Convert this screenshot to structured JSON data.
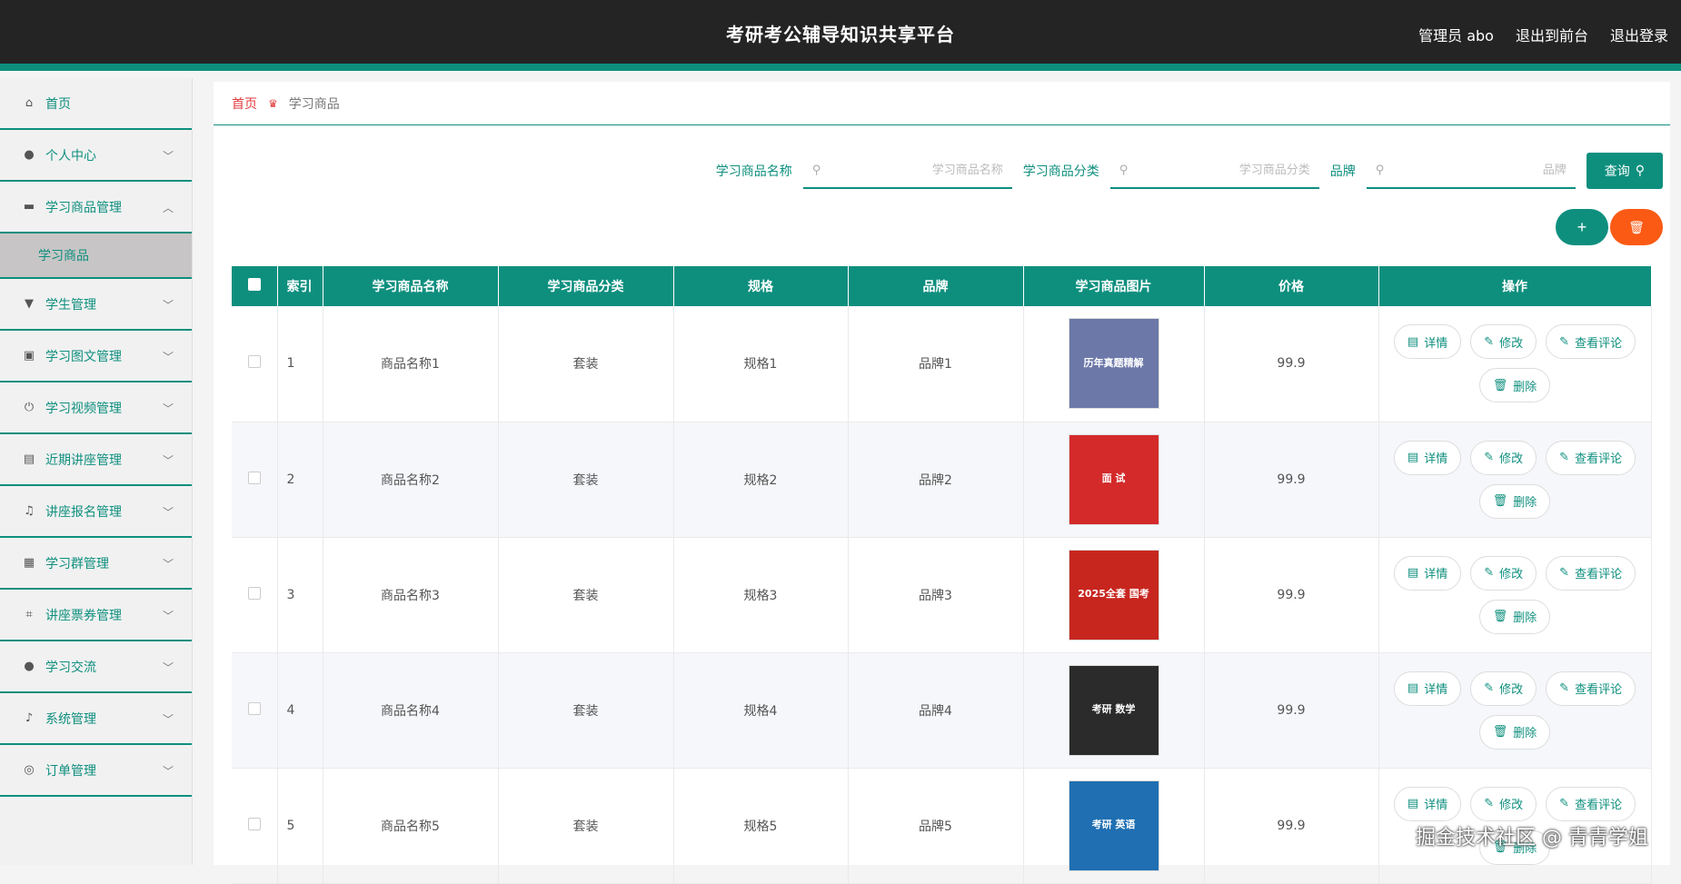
{
  "header": {
    "title": "考研考公辅导知识共享平台",
    "admin": "管理员 abo",
    "front_link": "退出到前台",
    "logout": "退出登录"
  },
  "sidebar": {
    "items": [
      {
        "label": "首页",
        "icon": "home-icon",
        "glyph": "⌂",
        "expandable": false
      },
      {
        "label": "个人中心",
        "icon": "user-icon",
        "glyph": "●",
        "expandable": true
      },
      {
        "label": "学习商品管理",
        "icon": "chat-icon",
        "glyph": "▬",
        "expandable": true,
        "expanded": true
      },
      {
        "label": "学生管理",
        "icon": "monitor-icon",
        "glyph": "▼",
        "expandable": true
      },
      {
        "label": "学习图文管理",
        "icon": "clipboard-icon",
        "glyph": "▣",
        "expandable": true
      },
      {
        "label": "学习视频管理",
        "icon": "power-icon",
        "glyph": "⏻",
        "expandable": true
      },
      {
        "label": "近期讲座管理",
        "icon": "briefcase-icon",
        "glyph": "▤",
        "expandable": true
      },
      {
        "label": "讲座报名管理",
        "icon": "bell-off-icon",
        "glyph": "♫",
        "expandable": true
      },
      {
        "label": "学习群管理",
        "icon": "clipboard-check-icon",
        "glyph": "▦",
        "expandable": true
      },
      {
        "label": "讲座票券管理",
        "icon": "crop-icon",
        "glyph": "⌗",
        "expandable": true
      },
      {
        "label": "学习交流",
        "icon": "person-icon",
        "glyph": "●",
        "expandable": true
      },
      {
        "label": "系统管理",
        "icon": "mic-icon",
        "glyph": "♪",
        "expandable": true
      },
      {
        "label": "订单管理",
        "icon": "compass-icon",
        "glyph": "◎",
        "expandable": true
      }
    ],
    "submenu": {
      "label": "学习商品"
    }
  },
  "breadcrumb": {
    "home": "首页",
    "current": "学习商品"
  },
  "search": {
    "name_label": "学习商品名称",
    "name_placeholder": "学习商品名称",
    "category_label": "学习商品分类",
    "category_placeholder": "学习商品分类",
    "brand_label": "品牌",
    "brand_placeholder": "品牌",
    "query_button": "查询"
  },
  "actions": {
    "add": "+",
    "delete": "🗑"
  },
  "table": {
    "headers": [
      "索引",
      "学习商品名称",
      "学习商品分类",
      "规格",
      "品牌",
      "学习商品图片",
      "价格",
      "操作"
    ],
    "rows": [
      {
        "index": "1",
        "name": "商品名称1",
        "category": "套装",
        "spec": "规格1",
        "brand": "品牌1",
        "price": "99.9",
        "thumb_text": "历年真题精解",
        "thumb_color": "#6b78a8"
      },
      {
        "index": "2",
        "name": "商品名称2",
        "category": "套装",
        "spec": "规格2",
        "brand": "品牌2",
        "price": "99.9",
        "thumb_text": "面 试",
        "thumb_color": "#d42a2a"
      },
      {
        "index": "3",
        "name": "商品名称3",
        "category": "套装",
        "spec": "规格3",
        "brand": "品牌3",
        "price": "99.9",
        "thumb_text": "2025全套 国考",
        "thumb_color": "#c7261f"
      },
      {
        "index": "4",
        "name": "商品名称4",
        "category": "套装",
        "spec": "规格4",
        "brand": "品牌4",
        "price": "99.9",
        "thumb_text": "考研 数学",
        "thumb_color": "#2b2b2b"
      },
      {
        "index": "5",
        "name": "商品名称5",
        "category": "套装",
        "spec": "规格5",
        "brand": "品牌5",
        "price": "99.9",
        "thumb_text": "考研 英语",
        "thumb_color": "#1f6fb2"
      }
    ],
    "op_labels": {
      "detail": "详情",
      "edit": "修改",
      "comments": "查看评论",
      "delete": "删除"
    }
  },
  "overlay": {
    "corner": "掘金技术社区 @ 青青学姐"
  },
  "colors": {
    "accent": "#0e8f7e",
    "danger": "#fa5a14",
    "header_bg": "#242424"
  }
}
